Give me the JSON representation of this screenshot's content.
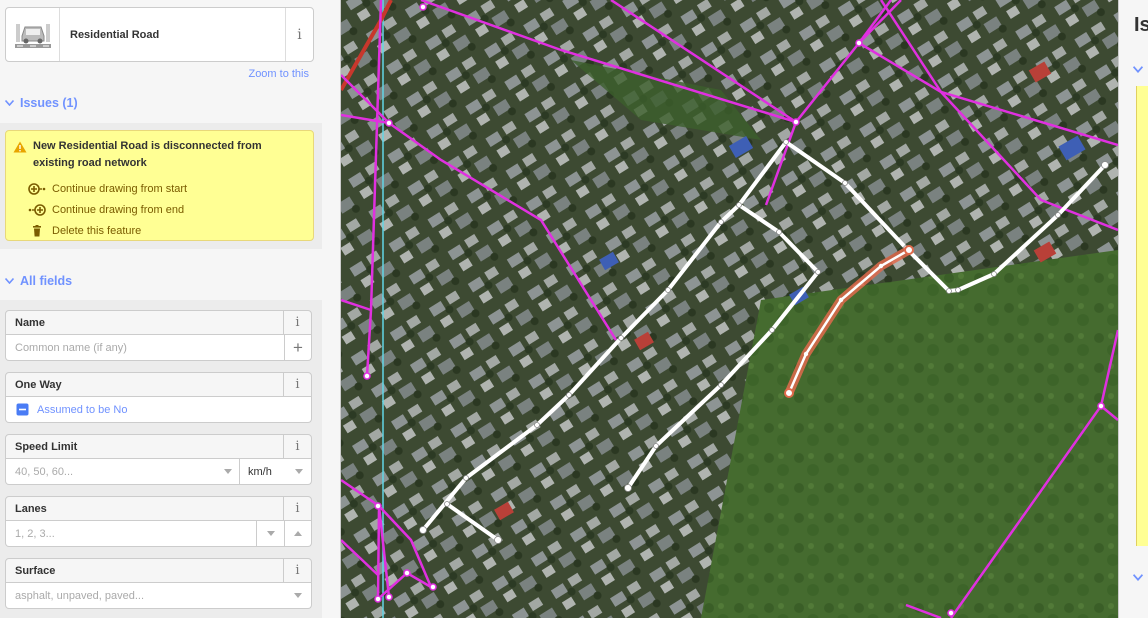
{
  "preset": {
    "name": "Residential Road",
    "icon": "car-road-icon",
    "info": "i"
  },
  "zoom_link": "Zoom to this",
  "issues": {
    "header": "Issues (1)",
    "message": "New Residential Road is disconnected from existing road network",
    "fixes": [
      {
        "label": "Continue drawing from start",
        "icon": "continue-start-icon"
      },
      {
        "label": "Continue drawing from end",
        "icon": "continue-end-icon"
      },
      {
        "label": "Delete this feature",
        "icon": "trash-icon"
      }
    ]
  },
  "fields": {
    "header": "All fields",
    "name": {
      "label": "Name",
      "placeholder": "Common name (if any)",
      "add": "+"
    },
    "oneway": {
      "label": "One Way",
      "value": "Assumed to be No"
    },
    "speed": {
      "label": "Speed Limit",
      "placeholder": "40, 50, 60...",
      "unit": "km/h"
    },
    "lanes": {
      "label": "Lanes",
      "placeholder": "1, 2, 3..."
    },
    "surface": {
      "label": "Surface",
      "placeholder": "asphalt, unpaved, paved..."
    },
    "info": "i"
  },
  "right_panel": {
    "title": "Is"
  },
  "colors": {
    "accent": "#7092ff",
    "warning_bg": "#ffff94",
    "magenta": "#e030e0",
    "selected": "#e06a4c"
  }
}
